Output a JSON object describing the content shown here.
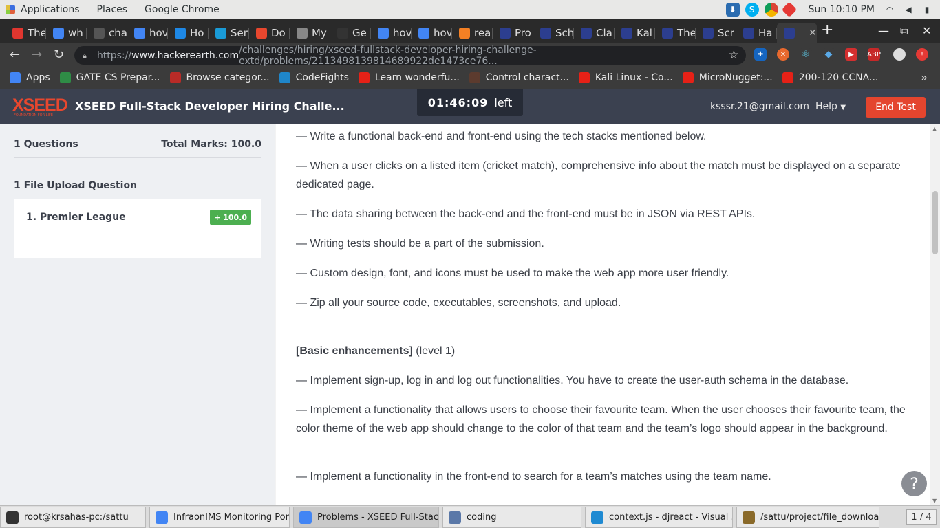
{
  "system_bar": {
    "menus": [
      "Applications",
      "Places",
      "Google Chrome"
    ],
    "clock": "Sun 10:10 PM"
  },
  "tabs": [
    {
      "label": "The",
      "icon_color": "#e0362f"
    },
    {
      "label": "wh",
      "icon_color": "#4285f4"
    },
    {
      "label": "cha",
      "icon_color": "#555555"
    },
    {
      "label": "hov",
      "icon_color": "#4285f4"
    },
    {
      "label": "Ho",
      "icon_color": "#1e88e5"
    },
    {
      "label": "Ser",
      "icon_color": "#1a9bd7"
    },
    {
      "label": "Do",
      "icon_color": "#e8472e"
    },
    {
      "label": "My",
      "icon_color": "#888888"
    },
    {
      "label": "Ge",
      "icon_color": "#333333"
    },
    {
      "label": "hov",
      "icon_color": "#4285f4"
    },
    {
      "label": "hov",
      "icon_color": "#4285f4"
    },
    {
      "label": "rea",
      "icon_color": "#f48024"
    },
    {
      "label": "Pro",
      "icon_color": "#2c3e8f"
    },
    {
      "label": "Sch",
      "icon_color": "#2c3e8f"
    },
    {
      "label": "Cla",
      "icon_color": "#2c3e8f"
    },
    {
      "label": "Kal",
      "icon_color": "#2c3e8f"
    },
    {
      "label": "The",
      "icon_color": "#2c3e8f"
    },
    {
      "label": "Scr",
      "icon_color": "#2c3e8f"
    },
    {
      "label": "Ha",
      "icon_color": "#2c3e8f"
    },
    {
      "label": "",
      "icon_color": "#2c3e8f"
    }
  ],
  "address": {
    "scheme": "https://",
    "host": "www.hackerearth.com",
    "path": "/challenges/hiring/xseed-fullstack-developer-hiring-challenge-extd/problems/2113498139814689922de1473ce76..."
  },
  "bookmarks": [
    {
      "label": "Apps",
      "icon_color": "#4285f4"
    },
    {
      "label": "GATE CS Prepar...",
      "icon_color": "#2f8d46"
    },
    {
      "label": "Browse categor...",
      "icon_color": "#b92b27"
    },
    {
      "label": "CodeFights",
      "icon_color": "#1f86c9"
    },
    {
      "label": "Learn wonderfu...",
      "icon_color": "#e62117"
    },
    {
      "label": "Control charact...",
      "icon_color": "#5c3b2e"
    },
    {
      "label": "Kali Linux - Co...",
      "icon_color": "#e62117"
    },
    {
      "label": "MicroNugget:...",
      "icon_color": "#e62117"
    },
    {
      "label": "200-120 CCNA...",
      "icon_color": "#e62117"
    }
  ],
  "header": {
    "logo_text": "XSEED",
    "logo_tagline": "FOUNDATION FOR LIFE",
    "title": "XSEED Full-Stack Developer Hiring Challe...",
    "timer_value": "01:46:09",
    "timer_suffix": "left",
    "user_email": "ksssr.21@gmail.com",
    "help_label": "Help",
    "end_test_label": "End Test"
  },
  "sidebar": {
    "questions_count": "1 Questions",
    "total_marks": "Total Marks: 100.0",
    "section_title": "1 File Upload Question",
    "question_name": "1. Premier League",
    "question_score": "+ 100.0"
  },
  "content": {
    "lines": [
      "— Write a functional back-end and front-end using the tech stacks mentioned below.",
      "— When a user clicks on a listed item (cricket match), comprehensive info about the match must be displayed on a separate dedicated page.",
      "— The data sharing between the back-end and the front-end must be in JSON via REST APIs.",
      "— Writing tests should be a part of the submission.",
      "— Custom design, font, and icons must be used to make the web app more user friendly.",
      "— Zip all your source code, executables, screenshots, and upload."
    ],
    "section_heading": "[Basic enhancements]",
    "section_level": " (level 1)",
    "enhancements": [
      "— Implement sign-up, log in and log out functionalities. You have to create the user-auth schema in the database.",
      "— Implement a functionality that allows users to choose their favourite team. When the user chooses their favourite team, the color theme of the web app should change to the color of that team and the team’s logo should appear in the background.",
      "— Implement a functionality in the front-end to search for a team’s matches using the team name."
    ]
  },
  "taskbar": {
    "items": [
      {
        "label": "root@krsahas-pc:/sattu",
        "icon_color": "#333333"
      },
      {
        "label": "InfraonIMS Monitoring Port...",
        "icon_color": "#4285f4"
      },
      {
        "label": "Problems - XSEED Full-Stac...",
        "icon_color": "#4285f4"
      },
      {
        "label": "coding",
        "icon_color": "#5a78a8"
      },
      {
        "label": "context.js - djreact - Visual ...",
        "icon_color": "#1f8ad2"
      },
      {
        "label": "/sattu/project/file_downloa...",
        "icon_color": "#8a6a2a"
      }
    ],
    "pager": "1 / 4"
  }
}
